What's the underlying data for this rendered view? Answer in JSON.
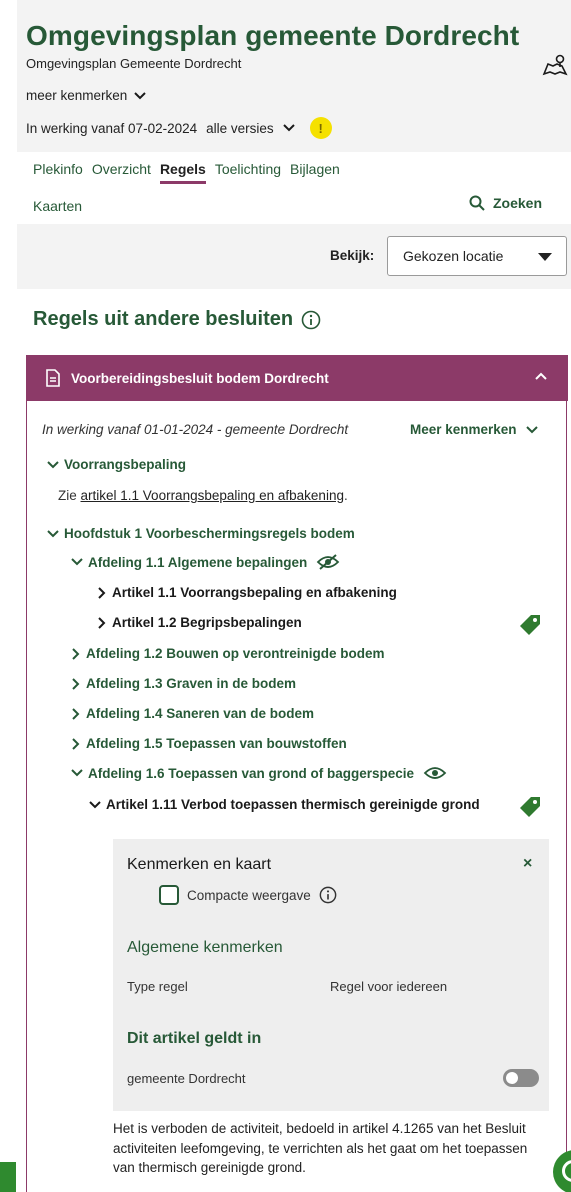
{
  "header": {
    "title": "Omgevingsplan gemeente Dordrecht",
    "subtitle": "Omgevingsplan Gemeente Dordrecht",
    "meer_kenmerken": "meer kenmerken",
    "in_werking": "In werking vanaf 07-02-2024",
    "alle_versies": "alle versies",
    "warning": "!"
  },
  "tabs": [
    "Plekinfo",
    "Overzicht",
    "Regels",
    "Toelichting",
    "Bijlagen"
  ],
  "active_tab": "Regels",
  "kaarten": "Kaarten",
  "zoeken": "Zoeken",
  "view": {
    "label": "Bekijk:",
    "selected": "Gekozen locatie"
  },
  "section_title": "Regels uit andere besluiten",
  "panel": {
    "title": "Voorbereidingsbesluit bodem Dordrecht",
    "meta": "In werking vanaf 01-01-2024 - gemeente Dordrecht",
    "meer_kenmerken": "Meer kenmerken",
    "voorrang": "Voorrangsbepaling",
    "zie_prefix": "Zie ",
    "zie_link": "artikel 1.1 Voorrangsbepaling en afbakening",
    "zie_suffix": ".",
    "hoofdstuk": "Hoofdstuk 1 Voorbeschermingsregels bodem",
    "afd11": "Afdeling 1.1 Algemene bepalingen",
    "art11": "Artikel 1.1 Voorrangsbepaling en afbakening",
    "art12": "Artikel 1.2 Begripsbepalingen",
    "afd12": "Afdeling 1.2 Bouwen op verontreinigde bodem",
    "afd13": "Afdeling 1.3 Graven in de bodem",
    "afd14": "Afdeling 1.4 Saneren van de bodem",
    "afd15": "Afdeling 1.5 Toepassen van bouwstoffen",
    "afd16": "Afdeling 1.6 Toepassen van grond of baggerspecie",
    "art111": "Artikel 1.11 Verbod toepassen thermisch gereinigde grond"
  },
  "kenmerken": {
    "title": "Kenmerken en kaart",
    "close": "×",
    "compact": "Compacte weergave",
    "algemene": "Algemene kenmerken",
    "type_label": "Type regel",
    "type_value": "Regel voor iedereen",
    "geldt_in": "Dit artikel geldt in",
    "location": "gemeente Dordrecht"
  },
  "body_text": "Het is verboden de activiteit, bedoeld in artikel 4.1265 van het Besluit activiteiten leefomgeving, te verrichten als het gaat om het toepassen van thermisch gereinigde grond.",
  "colors": {
    "brand_green": "#275937",
    "panel_purple": "#8c3a68",
    "warning_yellow": "#f5e100"
  }
}
